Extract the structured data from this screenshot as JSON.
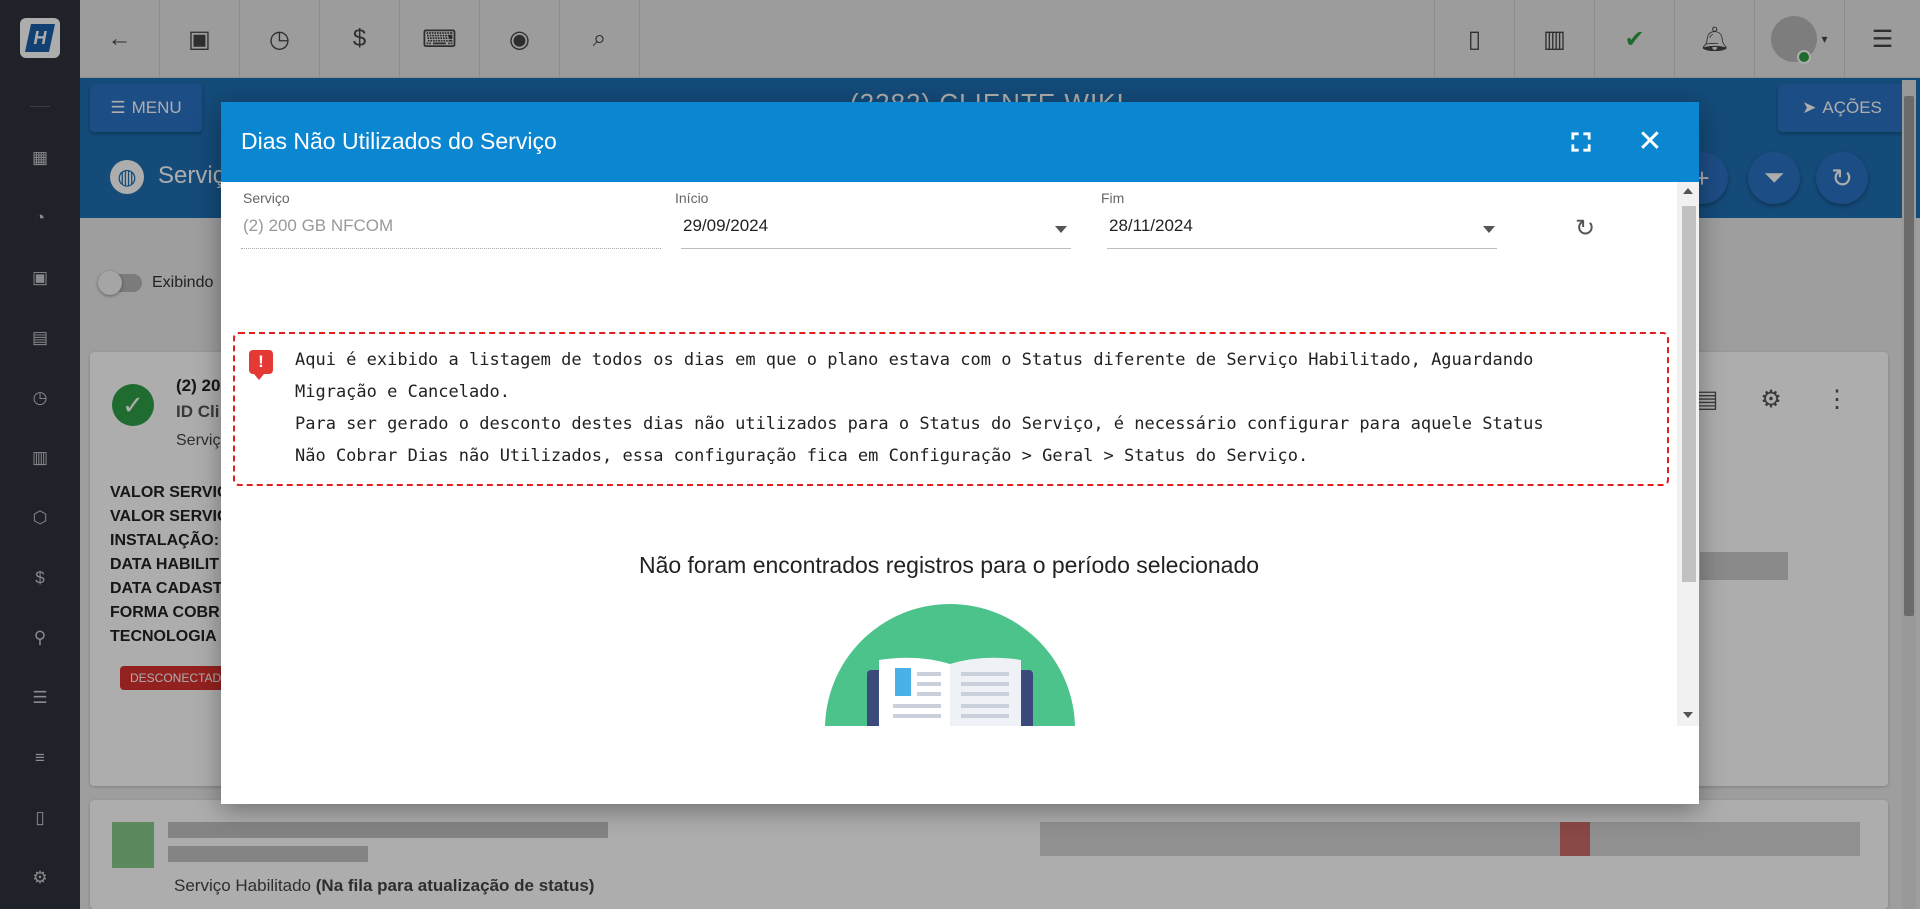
{
  "topbar": {
    "icons_left": [
      "back-arrow-icon",
      "contact-card-icon",
      "calendar-clock-icon",
      "dollar-icon",
      "terminal-icon",
      "eye-icon",
      "search-icon"
    ],
    "icons_right": [
      "pdf-icon",
      "id-badge-icon",
      "chat-check-icon",
      "bell-icon",
      "user-avatar",
      "list-icon"
    ]
  },
  "header": {
    "menu_label": "MENU",
    "page_title": "(2282) CLIENTE WIKI",
    "actions_label": "AÇÕES",
    "section_title": "Serviç"
  },
  "background": {
    "toggle_label": "Exibindo",
    "card": {
      "title": "(2) 20",
      "id_label": "ID Cli",
      "service_label": "Serviç",
      "fields": [
        "VALOR SERVIC",
        "VALOR SERVIC",
        "INSTALAÇÃO:",
        "DATA HABILIT",
        "DATA CADAST",
        "FORMA COBR",
        "TECNOLOGIA"
      ],
      "badge": "DESCONECTAD"
    },
    "card2_status": "Serviço Habilitado",
    "card2_status_extra": "(Na fila para atualização de status)"
  },
  "modal": {
    "title": "Dias Não Utilizados do Serviço",
    "service": {
      "label": "Serviço",
      "value": "(2) 200 GB NFCOM"
    },
    "start": {
      "label": "Início",
      "value": "29/09/2024"
    },
    "end": {
      "label": "Fim",
      "value": "28/11/2024"
    },
    "alert_lines": [
      "Aqui é exibido a listagem de todos os dias em que o plano estava com o Status diferente de Serviço Habilitado, Aguardando",
      "Migração e Cancelado.",
      "Para ser gerado o desconto destes dias não utilizados para o Status do Serviço, é necessário configurar para aquele Status",
      "Não Cobrar Dias não Utilizados, essa configuração fica em Configuração > Geral > Status do Serviço."
    ],
    "empty_message": "Não foram encontrados registros para o período selecionado"
  },
  "colors": {
    "modal_header": "#0b86d1",
    "page_header": "#1e6fb3",
    "alert_border": "#e11d1d",
    "illustration_green": "#4cc38a"
  }
}
